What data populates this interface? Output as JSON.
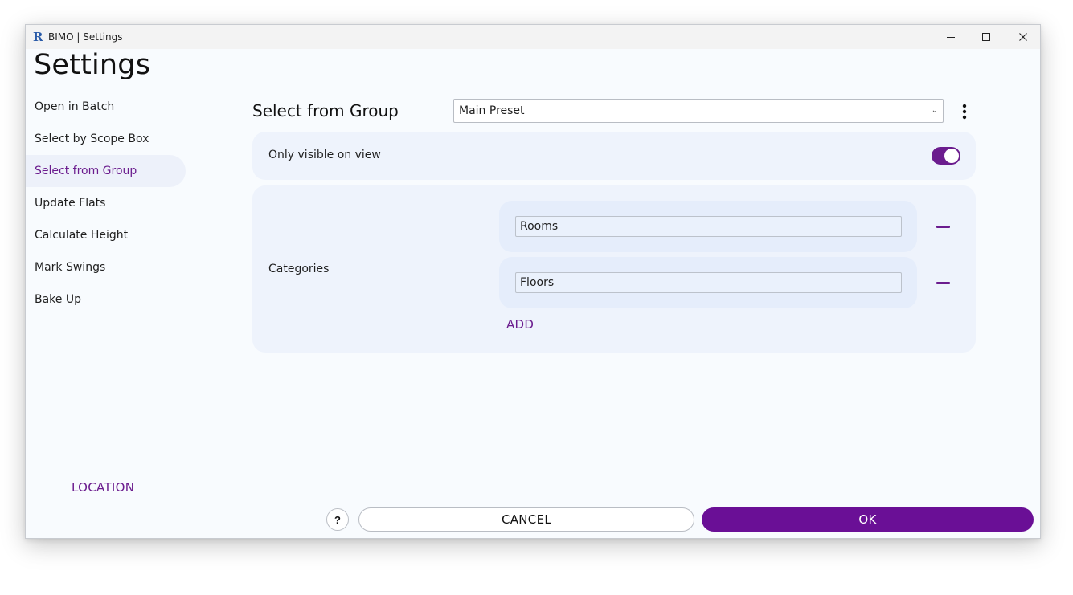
{
  "window": {
    "app_logo": "R",
    "title": "BIMO | Settings"
  },
  "page": {
    "heading": "Settings"
  },
  "sidebar": {
    "items": [
      {
        "label": "Open in Batch"
      },
      {
        "label": "Select by Scope Box"
      },
      {
        "label": "Select from Group",
        "active": true
      },
      {
        "label": "Update Flats"
      },
      {
        "label": "Calculate Height"
      },
      {
        "label": "Mark Swings"
      },
      {
        "label": "Bake Up"
      }
    ],
    "location_link": "LOCATION"
  },
  "main": {
    "section_title": "Select from Group",
    "preset": {
      "selected": "Main Preset",
      "caret": "⌄"
    },
    "only_visible": {
      "label": "Only visible on view",
      "enabled": true
    },
    "categories": {
      "label": "Categories",
      "items": [
        {
          "value": "Rooms"
        },
        {
          "value": "Floors"
        }
      ],
      "add_label": "ADD"
    }
  },
  "footer": {
    "help_label": "?",
    "cancel_label": "CANCEL",
    "ok_label": "OK"
  },
  "colors": {
    "accent": "#6b1c8e",
    "ok_button": "#6a0f96",
    "window_bg": "#f8fbfe",
    "card_bg": "#eef3fc",
    "active_item_bg": "#edf1fa"
  }
}
